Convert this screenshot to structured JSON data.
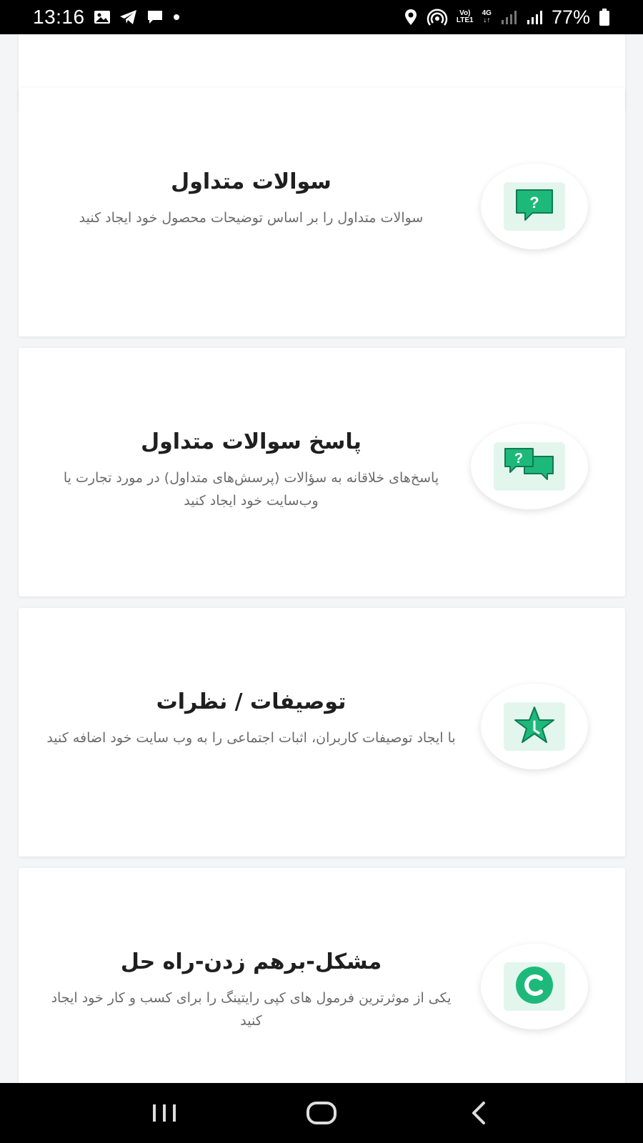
{
  "status_bar": {
    "time": "13:16",
    "network_top": "Vo)",
    "network_bottom": "LTE1",
    "network_type": "4G",
    "battery": "77%",
    "icons": [
      "gallery-icon",
      "telegram-icon",
      "message-icon",
      "dot-icon",
      "location-icon",
      "hotspot-icon",
      "signal-weak-icon",
      "signal-icon",
      "battery-icon"
    ]
  },
  "cards": [
    {
      "title": "سوالات متداول",
      "description": "سوالات متداول را بر اساس توضیحات محصول خود ایجاد کنید",
      "icon": "faq-bubble-icon"
    },
    {
      "title": "پاسخ سوالات متداول",
      "description": "پاسخ‌های خلاقانه به سؤالات (پرسش‌های متداول) در مورد تجارت یا وب‌سایت خود ایجاد کنید",
      "icon": "faq-answers-icon"
    },
    {
      "title": "توصیفات / نظرات",
      "description": "با ایجاد توصیفات کاربران، اثبات اجتماعی را به وب سایت خود اضافه کنید",
      "icon": "star-icon"
    },
    {
      "title": "مشکل-برهم زدن-راه حل",
      "description": "یکی از موثرترین فرمول های کپی رایتینگ را برای کسب و کار خود ایجاد کنید",
      "icon": "copyright-c-icon"
    }
  ],
  "nav_bar": {
    "icons": [
      "recents-icon",
      "home-icon",
      "back-icon"
    ]
  },
  "colors": {
    "accent": "#1db97a",
    "tile_bg": "#e3f6ee"
  }
}
